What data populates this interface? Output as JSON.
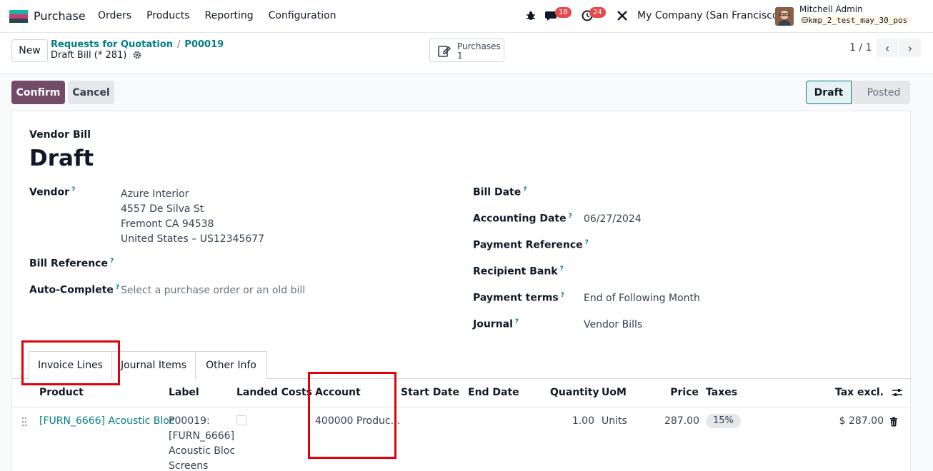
{
  "navbar": {
    "app_name": "Purchase",
    "menu": [
      "Orders",
      "Products",
      "Reporting",
      "Configuration"
    ],
    "messages_count": "18",
    "activities_count": "24",
    "company": "My Company (San Francisco)",
    "user_name": "Mitchell Admin",
    "db_name": "kmp_2_test_may_30_pos"
  },
  "control": {
    "new_label": "New",
    "breadcrumb_1": "Requests for Quotation",
    "breadcrumb_2": "P00019",
    "current": "Draft Bill (* 281)",
    "smart_label": "Purchases",
    "smart_count": "1",
    "pager": "1 / 1"
  },
  "statusbar": {
    "confirm_label": "Confirm",
    "cancel_label": "Cancel",
    "stage_draft": "Draft",
    "stage_posted": "Posted"
  },
  "form": {
    "doc_type": "Vendor Bill",
    "title": "Draft",
    "vendor_label": "Vendor",
    "vendor_lines": [
      "Azure Interior",
      "4557 De Silva St",
      "Fremont CA 94538",
      "United States – US12345677"
    ],
    "bill_reference_label": "Bill Reference",
    "auto_complete_label": "Auto-Complete",
    "auto_complete_placeholder": "Select a purchase order or an old bill",
    "bill_date_label": "Bill Date",
    "accounting_date_label": "Accounting Date",
    "accounting_date": "06/27/2024",
    "payment_reference_label": "Payment Reference",
    "recipient_bank_label": "Recipient Bank",
    "payment_terms_label": "Payment terms",
    "payment_terms": "End of Following Month",
    "journal_label": "Journal",
    "journal": "Vendor Bills",
    "help_mark": "?"
  },
  "tabs": [
    "Invoice Lines",
    "Journal Items",
    "Other Info"
  ],
  "table": {
    "headers": [
      "Product",
      "Label",
      "Landed Costs",
      "Account",
      "Start Date",
      "End Date",
      "Quantity",
      "UoM",
      "Price",
      "Taxes",
      "Tax excl."
    ],
    "row": {
      "product": "[FURN_6666] Acoustic Bloc",
      "label_lines": [
        "P00019:",
        "[FURN_6666]",
        "Acoustic Bloc",
        "Screens"
      ],
      "account": "400000 Produc…",
      "quantity": "1.00",
      "uom": "Units",
      "price": "287.00",
      "tax": "15%",
      "tax_excl": "$ 287.00"
    }
  },
  "colors": {
    "primary": "#714b67",
    "link": "#017e84",
    "highlight": "#e0010b"
  }
}
